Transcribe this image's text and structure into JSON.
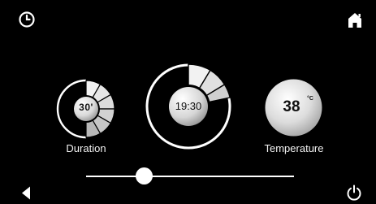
{
  "colors": {
    "background": "#000000",
    "foreground": "#ffffff",
    "segment_light": "#f2f2f2",
    "segment_shade": "#b4b4b4",
    "knob_light": "#ffffff",
    "knob_dark": "#8c8c8c"
  },
  "top_bar": {
    "left_icon": "clock-icon",
    "right_icon": "home-icon"
  },
  "duration_dial": {
    "value_text": "30'",
    "label": "Duration"
  },
  "time_dial": {
    "value_text": "19:30"
  },
  "temperature_dial": {
    "value": "38",
    "unit": "°C",
    "label": "Temperature"
  },
  "slider": {
    "level": 0.26
  },
  "bottom_bar": {
    "left_icon": "back-arrow-icon",
    "right_icon": "power-icon"
  }
}
